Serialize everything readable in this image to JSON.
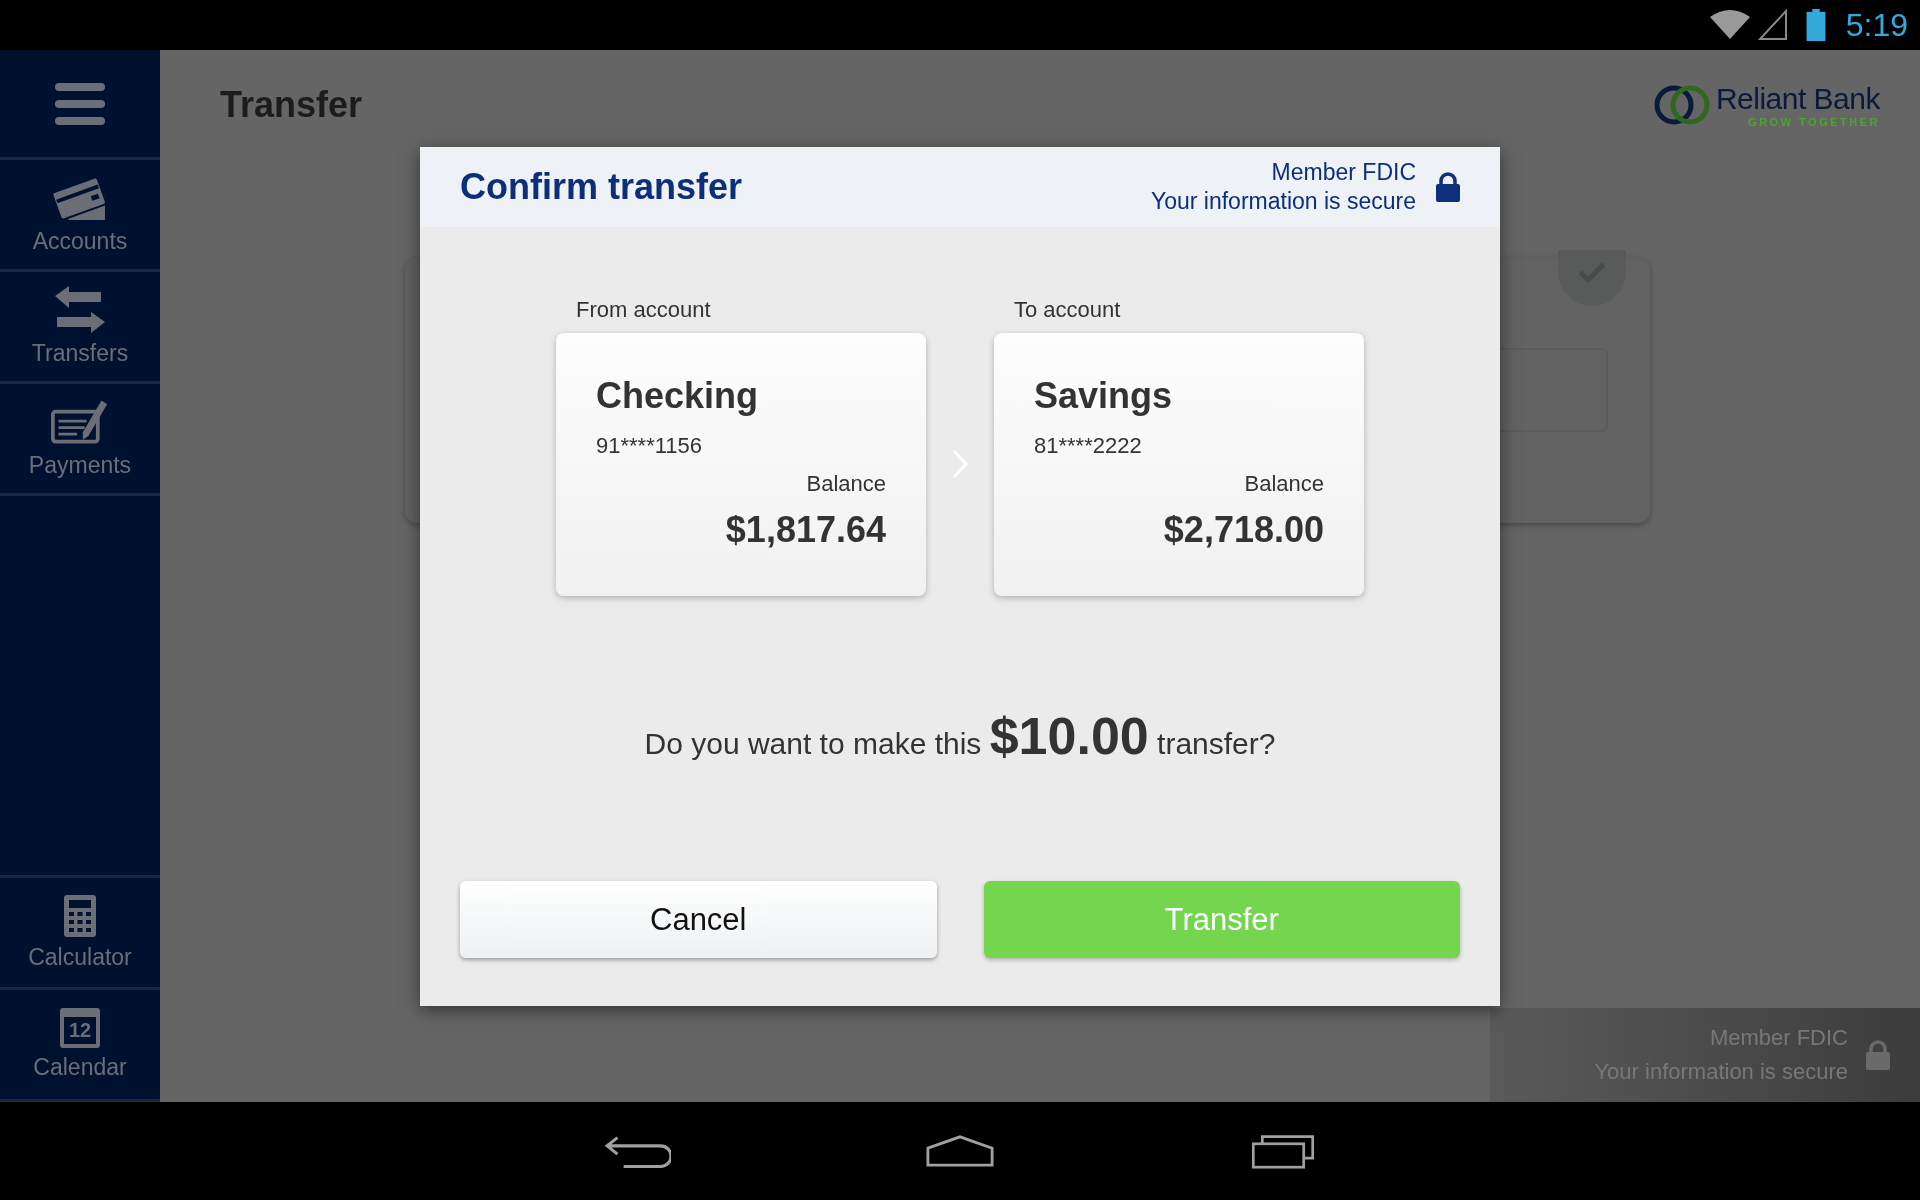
{
  "status_bar": {
    "time": "5:19"
  },
  "sidebar": {
    "items": [
      {
        "label": "Accounts",
        "kind": "cards"
      },
      {
        "label": "Transfers",
        "kind": "arrows"
      },
      {
        "label": "Payments",
        "kind": "check"
      }
    ],
    "bottom_items": [
      {
        "label": "Calculator",
        "kind": "calculator"
      },
      {
        "label": "Calendar",
        "kind": "calendar",
        "icon_text": "12"
      }
    ]
  },
  "page": {
    "title": "Transfer"
  },
  "logo": {
    "name": "Reliant Bank",
    "tagline": "GROW TOGETHER"
  },
  "footer": {
    "lines": [
      "Member FDIC",
      "Your information is secure"
    ]
  },
  "dialog": {
    "title": "Confirm transfer",
    "security": [
      "Member FDIC",
      "Your information is secure"
    ],
    "accounts": [
      {
        "label": "From account",
        "name": "Checking",
        "number": "91****1156",
        "balance_label": "Balance",
        "balance": "$1,817.64"
      },
      {
        "label": "To account",
        "name": "Savings",
        "number": "81****2222",
        "balance_label": "Balance",
        "balance": "$2,718.00"
      }
    ],
    "question": "Do you want to make this **$10.00** transfer?",
    "buttons": [
      {
        "label": "Cancel",
        "kind": "secondary"
      },
      {
        "label": "Transfer",
        "kind": "primary"
      }
    ]
  }
}
